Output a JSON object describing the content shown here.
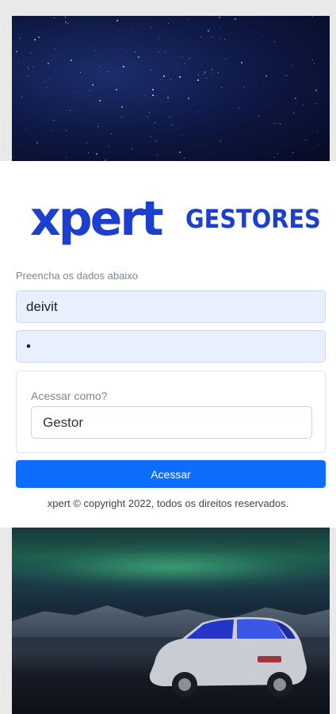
{
  "brand": {
    "logo_word": "xpert",
    "logo_sub": "GESTORES",
    "color": "#1c3fd0",
    "accent": "#2fd6c8"
  },
  "form": {
    "instruction": "Preencha os dados abaixo",
    "username_value": "deivit",
    "password_value": "•",
    "role_label": "Acessar como?",
    "role_selected": "Gestor",
    "submit_label": "Acessar",
    "submit_color": "#0d6efd"
  },
  "footer": {
    "text": "xpert © copyright 2022, todos os direitos reservados."
  }
}
